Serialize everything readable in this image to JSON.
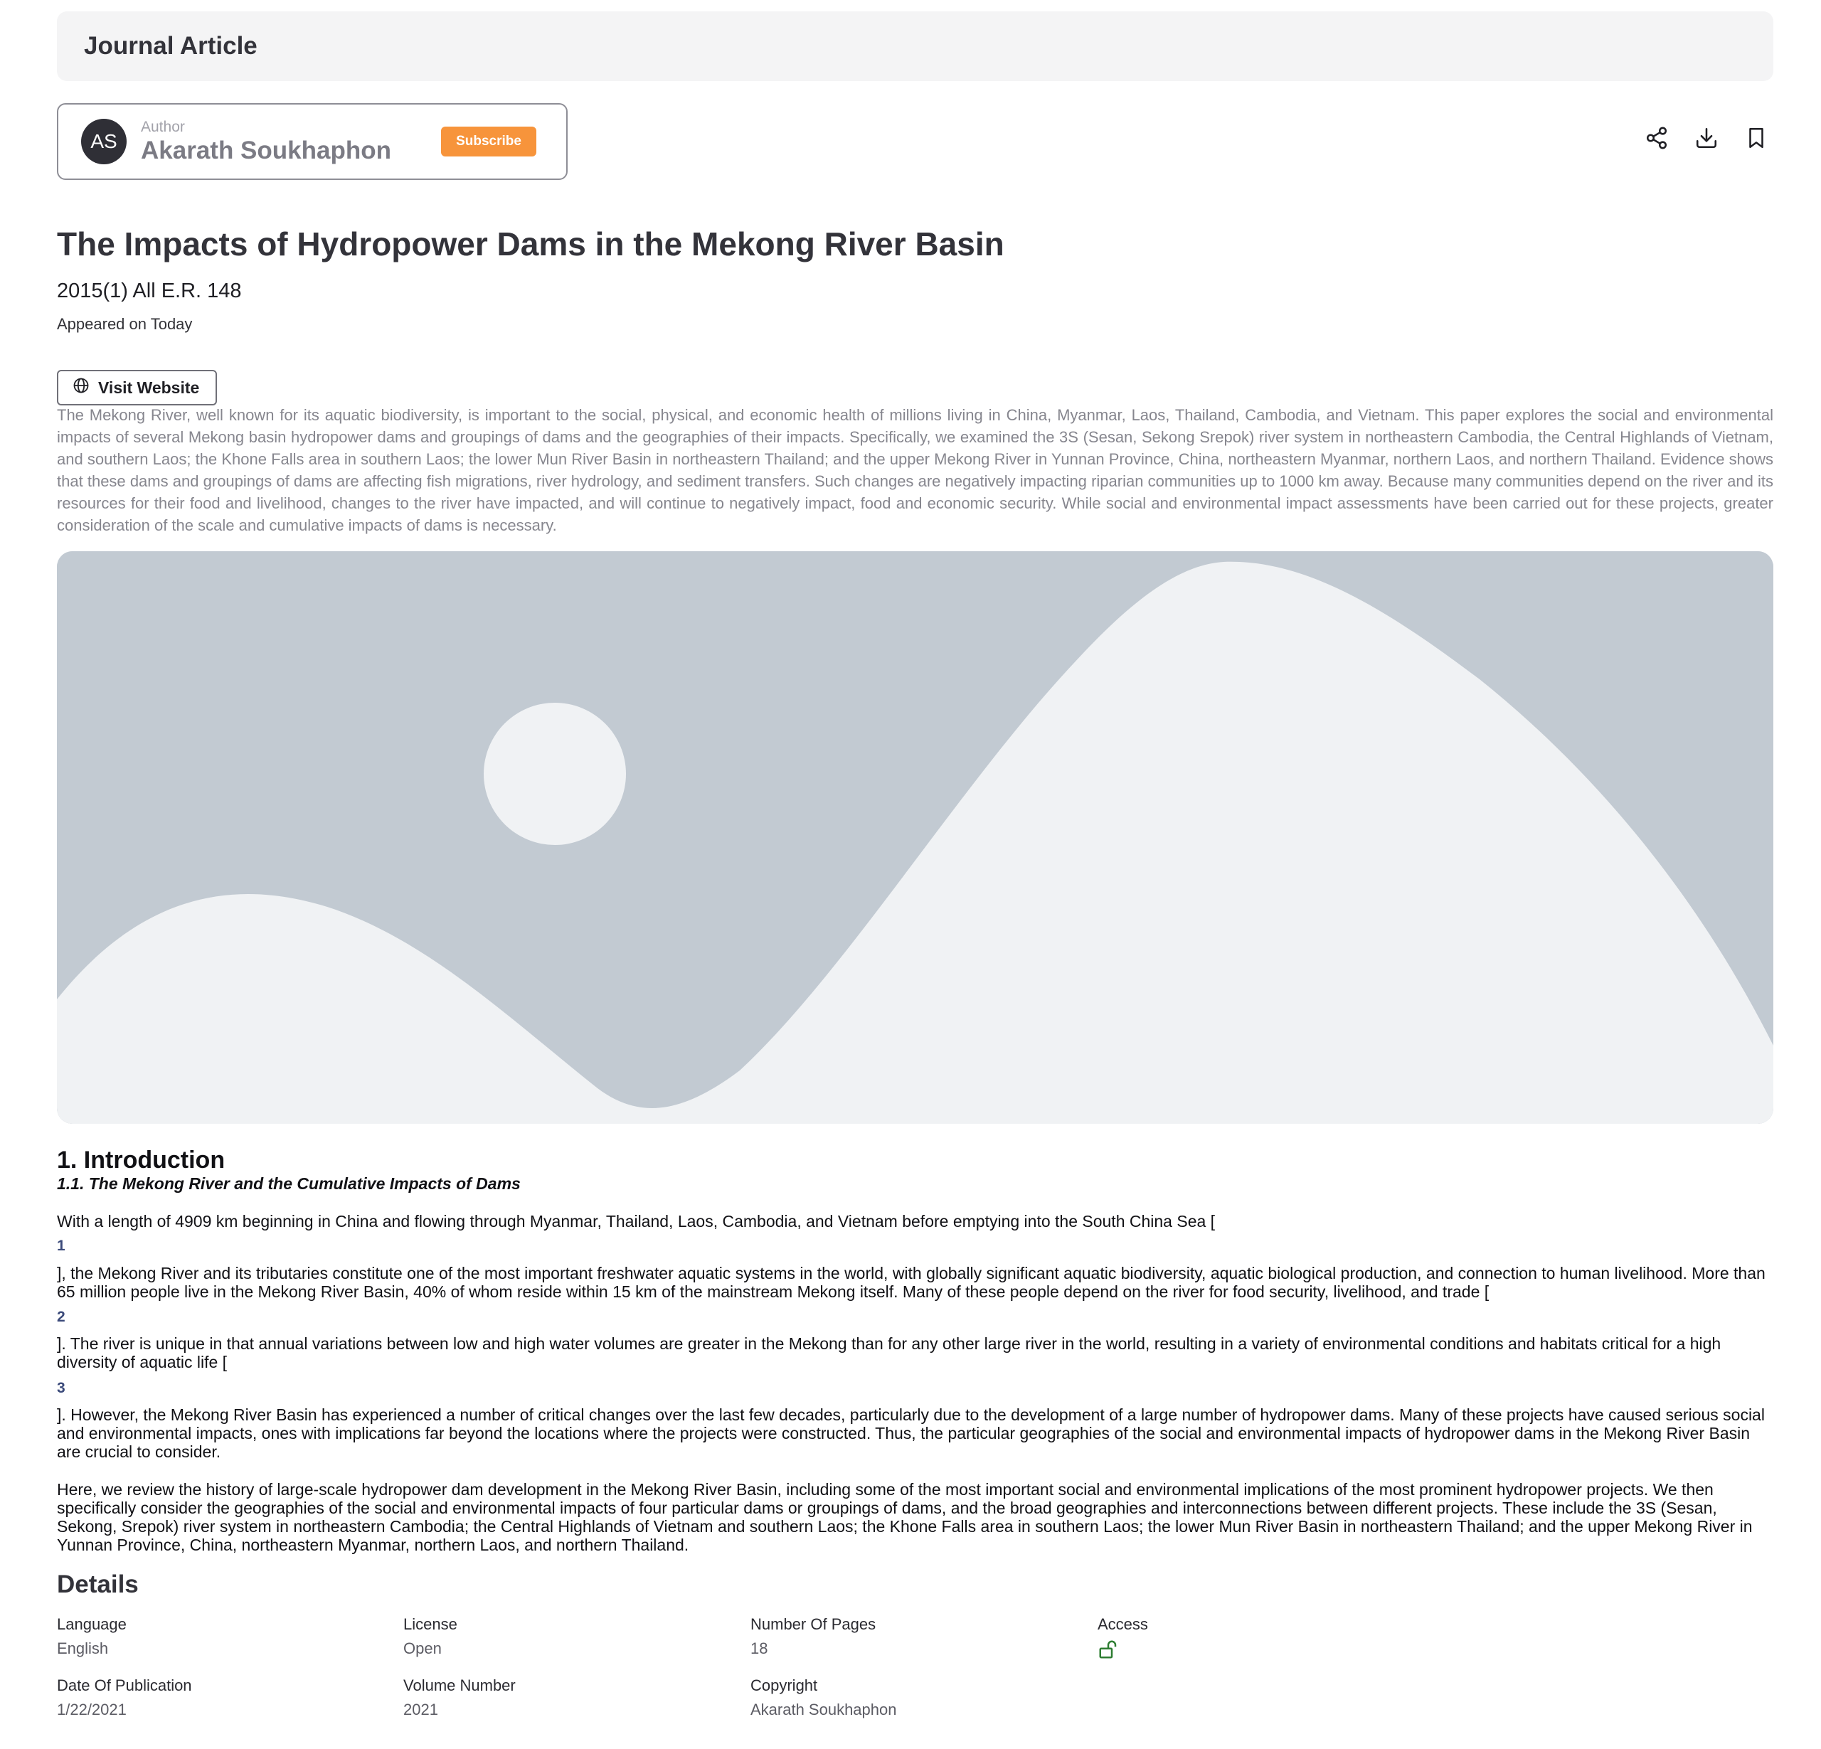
{
  "header": {
    "title": "Journal Article"
  },
  "author": {
    "initials": "AS",
    "label": "Author",
    "name": "Akarath Soukhaphon",
    "subscribe_label": "Subscribe"
  },
  "actions": {
    "share_icon": "share-icon",
    "download_icon": "download-icon",
    "bookmark_icon": "bookmark-icon"
  },
  "article": {
    "title": "The Impacts of Hydropower Dams in the Mekong River Basin",
    "citation": "2015(1) All E.R. 148",
    "appeared": "Appeared on Today",
    "visit_label": "Visit Website",
    "abstract": "The Mekong River, well known for its aquatic biodiversity, is important to the social, physical, and economic health of millions living in China, Myanmar, Laos, Thailand, Cambodia, and Vietnam. This paper explores the social and environmental impacts of several Mekong basin hydropower dams and groupings of dams and the geographies of their impacts. Specifically, we examined the 3S (Sesan, Sekong Srepok) river system in northeastern Cambodia, the Central Highlands of Vietnam, and southern Laos; the Khone Falls area in southern Laos; the lower Mun River Basin in northeastern Thailand; and the upper Mekong River in Yunnan Province, China, northeastern Myanmar, northern Laos, and northern Thailand. Evidence shows that these dams and groupings of dams are affecting fish migrations, river hydrology, and sediment transfers. Such changes are negatively impacting riparian communities up to 1000 km away. Because many communities depend on the river and its resources for their food and livelihood, changes to the river have impacted, and will continue to negatively impact, food and economic security. While social and environmental impact assessments have been carried out for these projects, greater consideration of the scale and cumulative impacts of dams is necessary."
  },
  "intro": {
    "heading": "1. Introduction",
    "subheading": "1.1. The Mekong River and the Cumulative Impacts of Dams",
    "p1": "With a length of 4909 km beginning in China and flowing through Myanmar, Thailand, Laos, Cambodia, and Vietnam before emptying into the South China Sea [",
    "ref1": "1",
    "p2": "], the Mekong River and its tributaries constitute one of the most important freshwater aquatic systems in the world, with globally significant aquatic biodiversity, aquatic biological production, and connection to human livelihood. More than 65 million people live in the Mekong River Basin, 40% of whom reside within 15 km of the mainstream Mekong itself. Many of these people depend on the river for food security, livelihood, and trade [",
    "ref2": "2",
    "p3": "]. The river is unique in that annual variations between low and high water volumes are greater in the Mekong than for any other large river in the world, resulting in a variety of environmental conditions and habitats critical for a high diversity of aquatic life [",
    "ref3": "3",
    "p4": "]. However, the Mekong River Basin has experienced a number of critical changes over the last few decades, particularly due to the development of a large number of hydropower dams. Many of these projects have caused serious social and environmental impacts, ones with implications far beyond the locations where the projects were constructed. Thus, the particular geographies of the social and environmental impacts of hydropower dams in the Mekong River Basin are crucial to consider.",
    "p5": "Here, we review the history of large-scale hydropower dam development in the Mekong River Basin, including some of the most important social and environmental implications of the most prominent hydropower projects. We then specifically consider the geographies of the social and environmental impacts of four particular dams or groupings of dams, and the broad geographies and interconnections between different projects. These include the 3S (Sesan, Sekong, Srepok) river system in northeastern Cambodia; the Central Highlands of Vietnam and southern Laos; the Khone Falls area in southern Laos; the lower Mun River Basin in northeastern Thailand; and the upper Mekong River in Yunnan Province, China, northeastern Myanmar, northern Laos, and northern Thailand."
  },
  "details": {
    "heading": "Details",
    "language_label": "Language",
    "language_value": "English",
    "license_label": "License",
    "license_value": "Open",
    "pages_label": "Number Of Pages",
    "pages_value": "18",
    "access_label": "Access",
    "access_icon": "unlock-icon",
    "date_label": "Date Of Publication",
    "date_value": "1/22/2021",
    "volume_label": "Volume Number",
    "volume_value": "2021",
    "copyright_label": "Copyright",
    "copyright_value": "Akarath Soukhaphon"
  },
  "colors": {
    "accent": "#f7943b",
    "image_bg": "#c2cad2",
    "image_fg": "#f0f2f4",
    "access_green": "#2e7d32"
  }
}
